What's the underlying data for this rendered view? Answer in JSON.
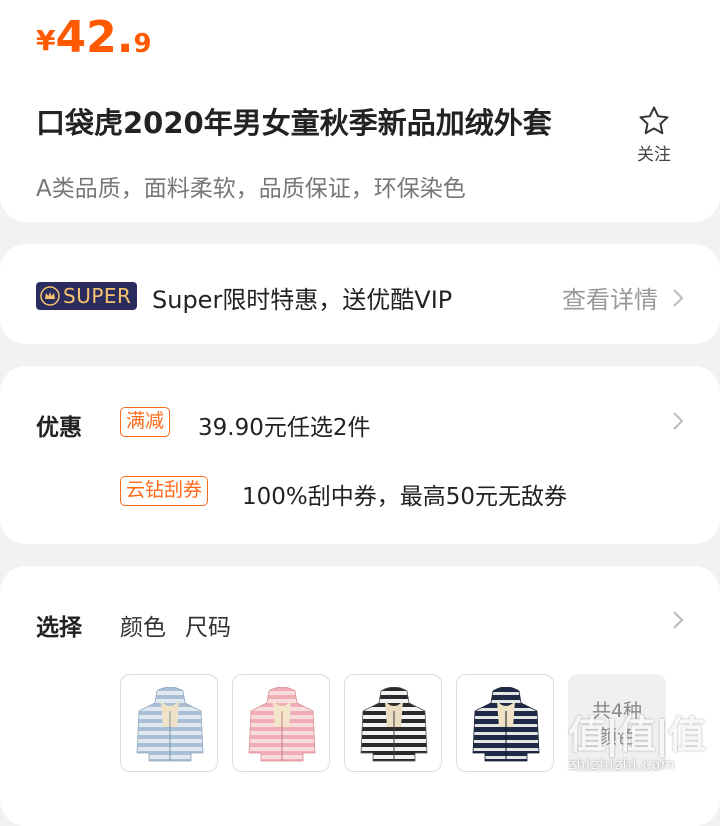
{
  "product": {
    "price": {
      "currency": "¥",
      "integer": "42.",
      "decimal": "9"
    },
    "title": "口袋虎2020年男女童秋季新品加绒外套",
    "subtitle": "A类品质，面料柔软，品质保证，环保染色",
    "favorite": {
      "icon": "star-outline-icon",
      "label": "关注"
    }
  },
  "super": {
    "badge": "SUPER",
    "text": "Super限时特惠，送优酷VIP",
    "link": "查看详情"
  },
  "promotions": {
    "label": "优惠",
    "items": [
      {
        "tag": "满减",
        "text": "39.90元任选2件"
      },
      {
        "tag": "云钻刮券",
        "text": "100%刮中券，最高50元无敌券"
      }
    ]
  },
  "selection": {
    "label": "选择",
    "options": [
      "颜色",
      "尺码"
    ],
    "thumbnails": [
      {
        "name": "light-blue-striped-jacket",
        "color": "#a9bfd6"
      },
      {
        "name": "pink-striped-jacket",
        "color": "#efaeb3"
      },
      {
        "name": "white-black-striped-jacket",
        "color": "#e8e8e8"
      },
      {
        "name": "navy-striped-jacket",
        "color": "#1f2a44"
      }
    ],
    "more": "共4种\n颜色"
  },
  "watermark": {
    "logo": "值|值|值",
    "url": "zhizhizhi.com"
  },
  "colors": {
    "accent": "#ff5a00",
    "super_bg": "#2b2c5e",
    "super_gold": "#f5c270"
  }
}
